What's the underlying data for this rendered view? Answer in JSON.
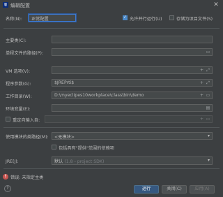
{
  "window": {
    "title": "编辑配置",
    "app_icon_label": "IJ"
  },
  "form": {
    "name_label": "名称(N):",
    "name_value": "正常配置",
    "allow_parallel_label": "允许并行运行(U)",
    "allow_parallel_checked": true,
    "store_as_file_label": "存储为项目文件(S)",
    "store_as_file_checked": false,
    "main_class_label": "主要类(C):",
    "main_class_value": "",
    "single_file_path_label": "单程文件的路径(P):",
    "single_file_path_value": "",
    "vm_options_label": "VM 选项(V):",
    "vm_options_value": "",
    "program_args_label": "程序参数(G):",
    "program_args_value": "$JREPrti$",
    "working_dir_label": "工作目录(W):",
    "working_dir_value": "D:\\myeclipes10workplace\\class\\bin\\demo",
    "env_vars_label": "环境变量(E):",
    "env_vars_value": "",
    "redirect_input_label": "重定向输入自:",
    "redirect_input_checked": false,
    "module_classpath_label": "使用模块的类路径(M):",
    "module_classpath_value": "<无模块>",
    "include_provided_label": "包括具有\"提供\"范围的依赖项",
    "include_provided_checked": false,
    "jre_label": "JRE(J):",
    "jre_value": "默认",
    "jre_hint": "(1.8 - project SDK)"
  },
  "error": {
    "text": "错误: 未指定主类"
  },
  "buttons": {
    "run": "运行",
    "close": "关闭(C)",
    "apply": "应用(A)",
    "help": "?"
  },
  "colors": {
    "accent": "#365880",
    "error": "#c75450",
    "background": "#3c3f41"
  }
}
